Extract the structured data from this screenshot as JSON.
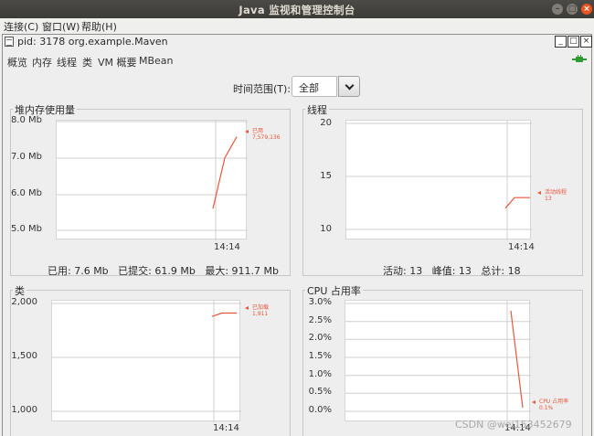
{
  "window": {
    "title": "Java 监视和管理控制台"
  },
  "menubar": {
    "items": [
      "连接(C)",
      "窗口(W)",
      "帮助(H)"
    ]
  },
  "frame": {
    "title": "pid: 3178 org.example.Maven"
  },
  "tabs": [
    "概览",
    "内存",
    "线程",
    "类",
    "VM 概要",
    "MBean"
  ],
  "time_range": {
    "label": "时间范围(T):",
    "value": "全部"
  },
  "panels": {
    "heap": {
      "title": "堆内存使用量",
      "y_ticks": [
        "8.0 Mb",
        "7.0 Mb",
        "6.0 Mb",
        "5.0 Mb"
      ],
      "x_tick": "14:14",
      "legend": [
        "已用",
        "7,579,136"
      ],
      "stats": [
        "已用: 7.6 Mb",
        "已提交: 61.9 Mb",
        "最大: 911.7 Mb"
      ]
    },
    "threads": {
      "title": "线程",
      "y_ticks": [
        "20",
        "15",
        "10"
      ],
      "x_tick": "14:14",
      "legend": [
        "活动线程",
        "13"
      ],
      "stats": [
        "活动: 13",
        "峰值: 13",
        "总计: 18"
      ]
    },
    "classes": {
      "title": "类",
      "y_ticks": [
        "2,000",
        "1,500",
        "1,000"
      ],
      "x_tick": "14:14",
      "legend": [
        "已加载",
        "1,911"
      ]
    },
    "cpu": {
      "title": "CPU 占用率",
      "y_ticks": [
        "3.0%",
        "2.5%",
        "2.0%",
        "1.5%",
        "1.0%",
        "0.5%",
        "0.0%"
      ],
      "x_tick": "14:14",
      "legend": [
        "CPU 占用率",
        "0.1%"
      ]
    }
  },
  "watermark": "CSDN @wei153452679",
  "colors": {
    "series": "#e8573a",
    "accent_close": "#e95420",
    "connected": "#2e9b2e"
  },
  "chart_data": [
    {
      "type": "line",
      "name": "heap",
      "ylim": [
        5.0,
        8.0
      ],
      "series": [
        {
          "name": "已用",
          "values": [
            5.6,
            7.0,
            7.579
          ]
        }
      ]
    },
    {
      "type": "line",
      "name": "threads",
      "ylim": [
        10,
        20
      ],
      "series": [
        {
          "name": "活动线程",
          "values": [
            12,
            13,
            13
          ]
        }
      ]
    },
    {
      "type": "line",
      "name": "classes",
      "ylim": [
        1000,
        2000
      ],
      "series": [
        {
          "name": "已加载",
          "values": [
            1880,
            1911,
            1911
          ]
        }
      ]
    },
    {
      "type": "line",
      "name": "cpu",
      "ylim": [
        0,
        3.0
      ],
      "series": [
        {
          "name": "CPU 占用率",
          "values": [
            2.8,
            0.1
          ]
        }
      ]
    }
  ]
}
